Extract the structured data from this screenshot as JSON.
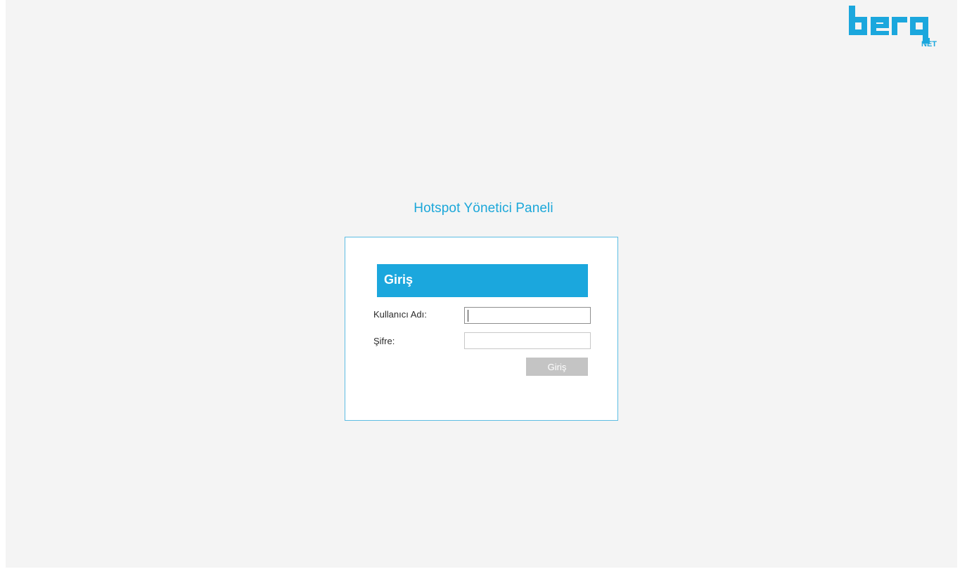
{
  "brand": {
    "logo_text": "berq",
    "logo_suffix": "NET",
    "color": "#1ba7dd"
  },
  "page": {
    "title": "Hotspot Yönetici Paneli"
  },
  "login": {
    "header": "Giriş",
    "username_label": "Kullanıcı Adı:",
    "username_value": "",
    "username_placeholder": "",
    "password_label": "Şifre:",
    "password_value": "",
    "password_placeholder": "",
    "submit_label": "Giriş"
  },
  "colors": {
    "accent": "#1ba7dd",
    "background": "#f4f4f4",
    "button": "#c4c4c4"
  }
}
